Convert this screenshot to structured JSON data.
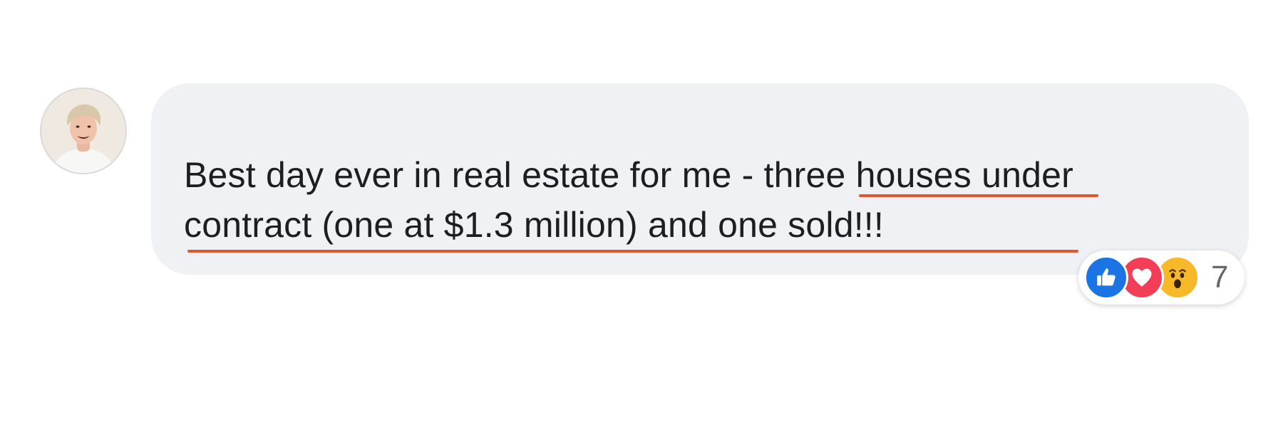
{
  "comment": {
    "author_avatar_icon": "user-avatar-photo",
    "text": "Best day ever in real estate for me - three houses under contract (one at $1.3 million) and one sold!!!",
    "highlight_color": "#e0582f",
    "bubble_color": "#f0f1f5"
  },
  "reactions": {
    "icons": [
      "like-icon",
      "love-icon",
      "wow-icon"
    ],
    "count": "7",
    "colors": {
      "like": "#1b74e4",
      "love": "#f33e58",
      "wow": "#f7b928"
    }
  }
}
